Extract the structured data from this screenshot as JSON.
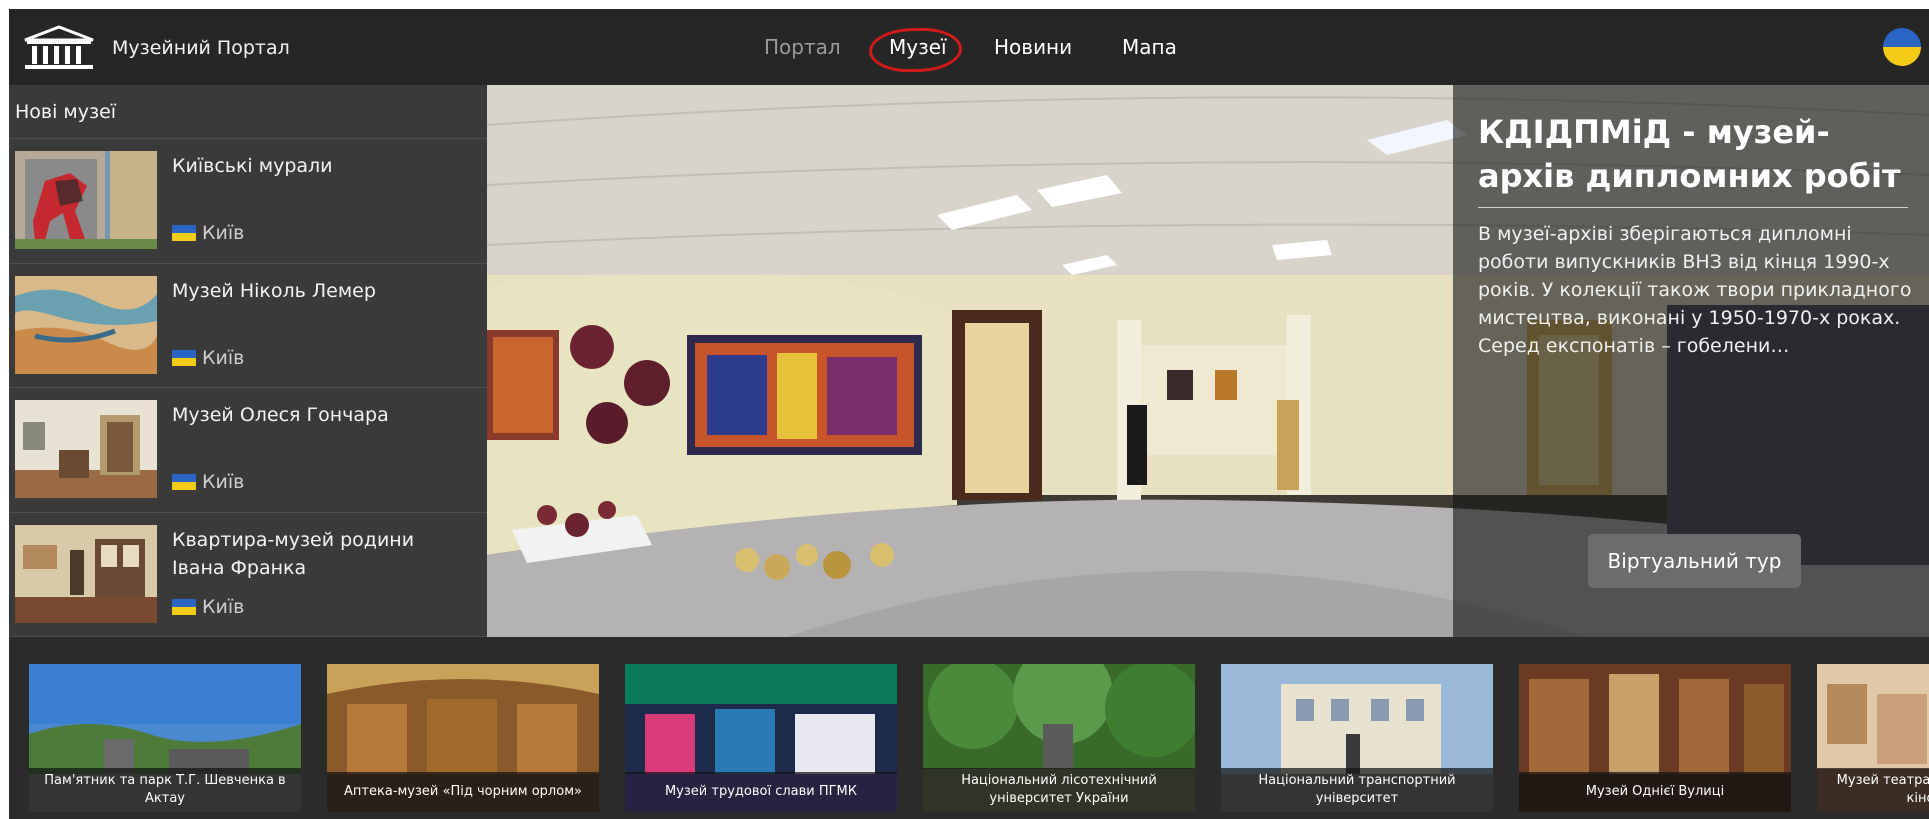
{
  "header": {
    "brand": "Музейний Портал",
    "logo_icon": "museum-building-icon",
    "nav": [
      {
        "label": "Портал",
        "active": false
      },
      {
        "label": "Музеї",
        "active": true
      },
      {
        "label": "Новини",
        "active": false
      },
      {
        "label": "Мапа",
        "active": false
      }
    ],
    "language_icon": "ukraine-flag-icon"
  },
  "sidebar": {
    "title": "Нові музеї",
    "items": [
      {
        "name": "Київські мурали",
        "city": "Київ"
      },
      {
        "name": "Музей Ніколь Лемер",
        "city": "Київ"
      },
      {
        "name": "Музей Олеся Гончара",
        "city": "Київ"
      },
      {
        "name": "Квартира-музей родини Івана Франка",
        "city": "Київ"
      }
    ]
  },
  "featured": {
    "title": "КДІДПМіД - музей-архів дипломних робіт",
    "description": "В музеї-архіві зберігаються дипломні роботи випускників ВНЗ від кінця 1990-х років. У колекції також твори прикладного мистецтва, виконані у 1950-1970-х роках. Серед експонатів – гобелени…",
    "button_label": "Віртуальний тур"
  },
  "carousel": [
    {
      "caption": "Пам'ятник та парк Т.Г. Шевченка в Актау"
    },
    {
      "caption": "Аптека-музей «Під чорним орлом»"
    },
    {
      "caption": "Музей трудової слави ПГМК"
    },
    {
      "caption": "Національний лісотехнічний університет України"
    },
    {
      "caption": "Національний транспортний університет"
    },
    {
      "caption": "Музей Однієї Вулиці"
    },
    {
      "caption": "Музей театрального, музичного та кіномистецтва"
    }
  ],
  "colors": {
    "header_bg": "#262626",
    "sidebar_bg": "#3a3a3a",
    "nav_highlight_circle": "#d11a1a",
    "flag_blue": "#2a64c5",
    "flag_yellow": "#f4cc17",
    "button_bg": "#6c6c6c"
  }
}
